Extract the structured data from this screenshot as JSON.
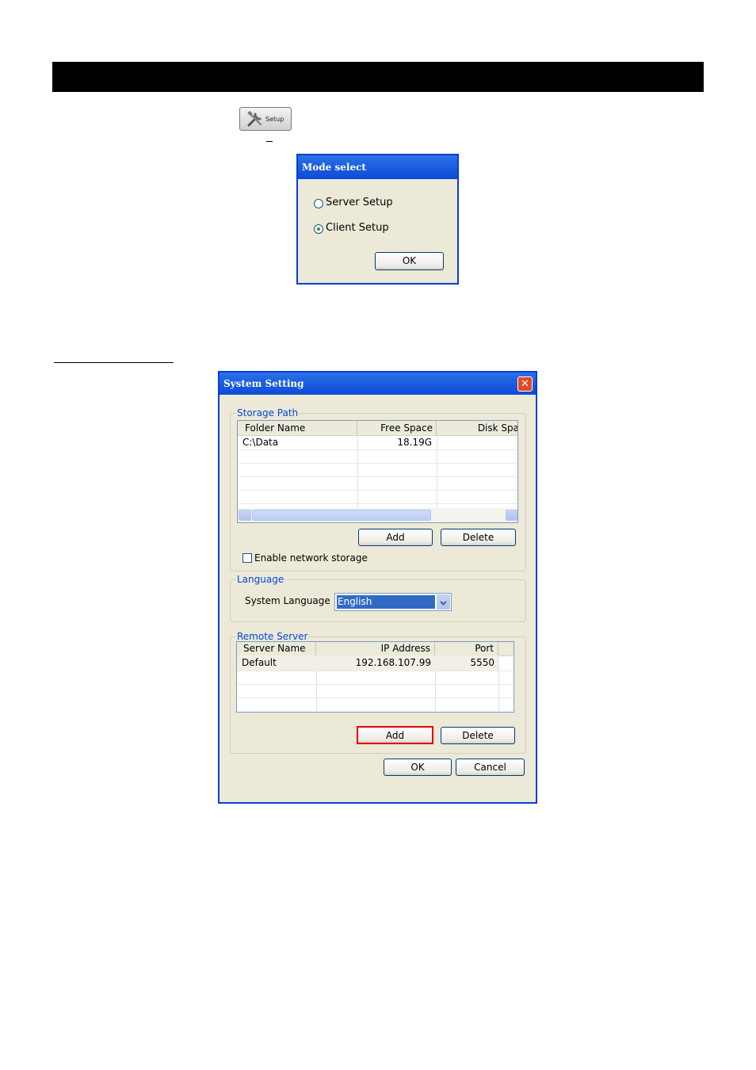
{
  "setup_button": {
    "label": "Setup"
  },
  "mode_dialog": {
    "title": "Mode select",
    "options": [
      {
        "label": "Server Setup",
        "selected": false
      },
      {
        "label": "Client Setup",
        "selected": true
      }
    ],
    "ok_label": "OK"
  },
  "system_dialog": {
    "title": "System Setting",
    "storage_path": {
      "group_label": "Storage Path",
      "columns": [
        "Folder Name",
        "Free Space",
        "Disk Spa"
      ],
      "rows": [
        [
          "C:\\Data",
          "18.19G",
          ""
        ]
      ],
      "add_label": "Add",
      "delete_label": "Delete",
      "network_storage_label": "Enable network storage",
      "network_storage_checked": false
    },
    "language": {
      "group_label": "Language",
      "field_label": "System Language",
      "selected": "English"
    },
    "remote_server": {
      "group_label": "Remote Server",
      "columns": [
        "Server Name",
        "IP Address",
        "Port"
      ],
      "rows": [
        [
          "Default",
          "192.168.107.99",
          "5550"
        ]
      ],
      "add_label": "Add",
      "delete_label": "Delete",
      "highlight_color": "#e00000"
    },
    "ok_label": "OK",
    "cancel_label": "Cancel"
  }
}
